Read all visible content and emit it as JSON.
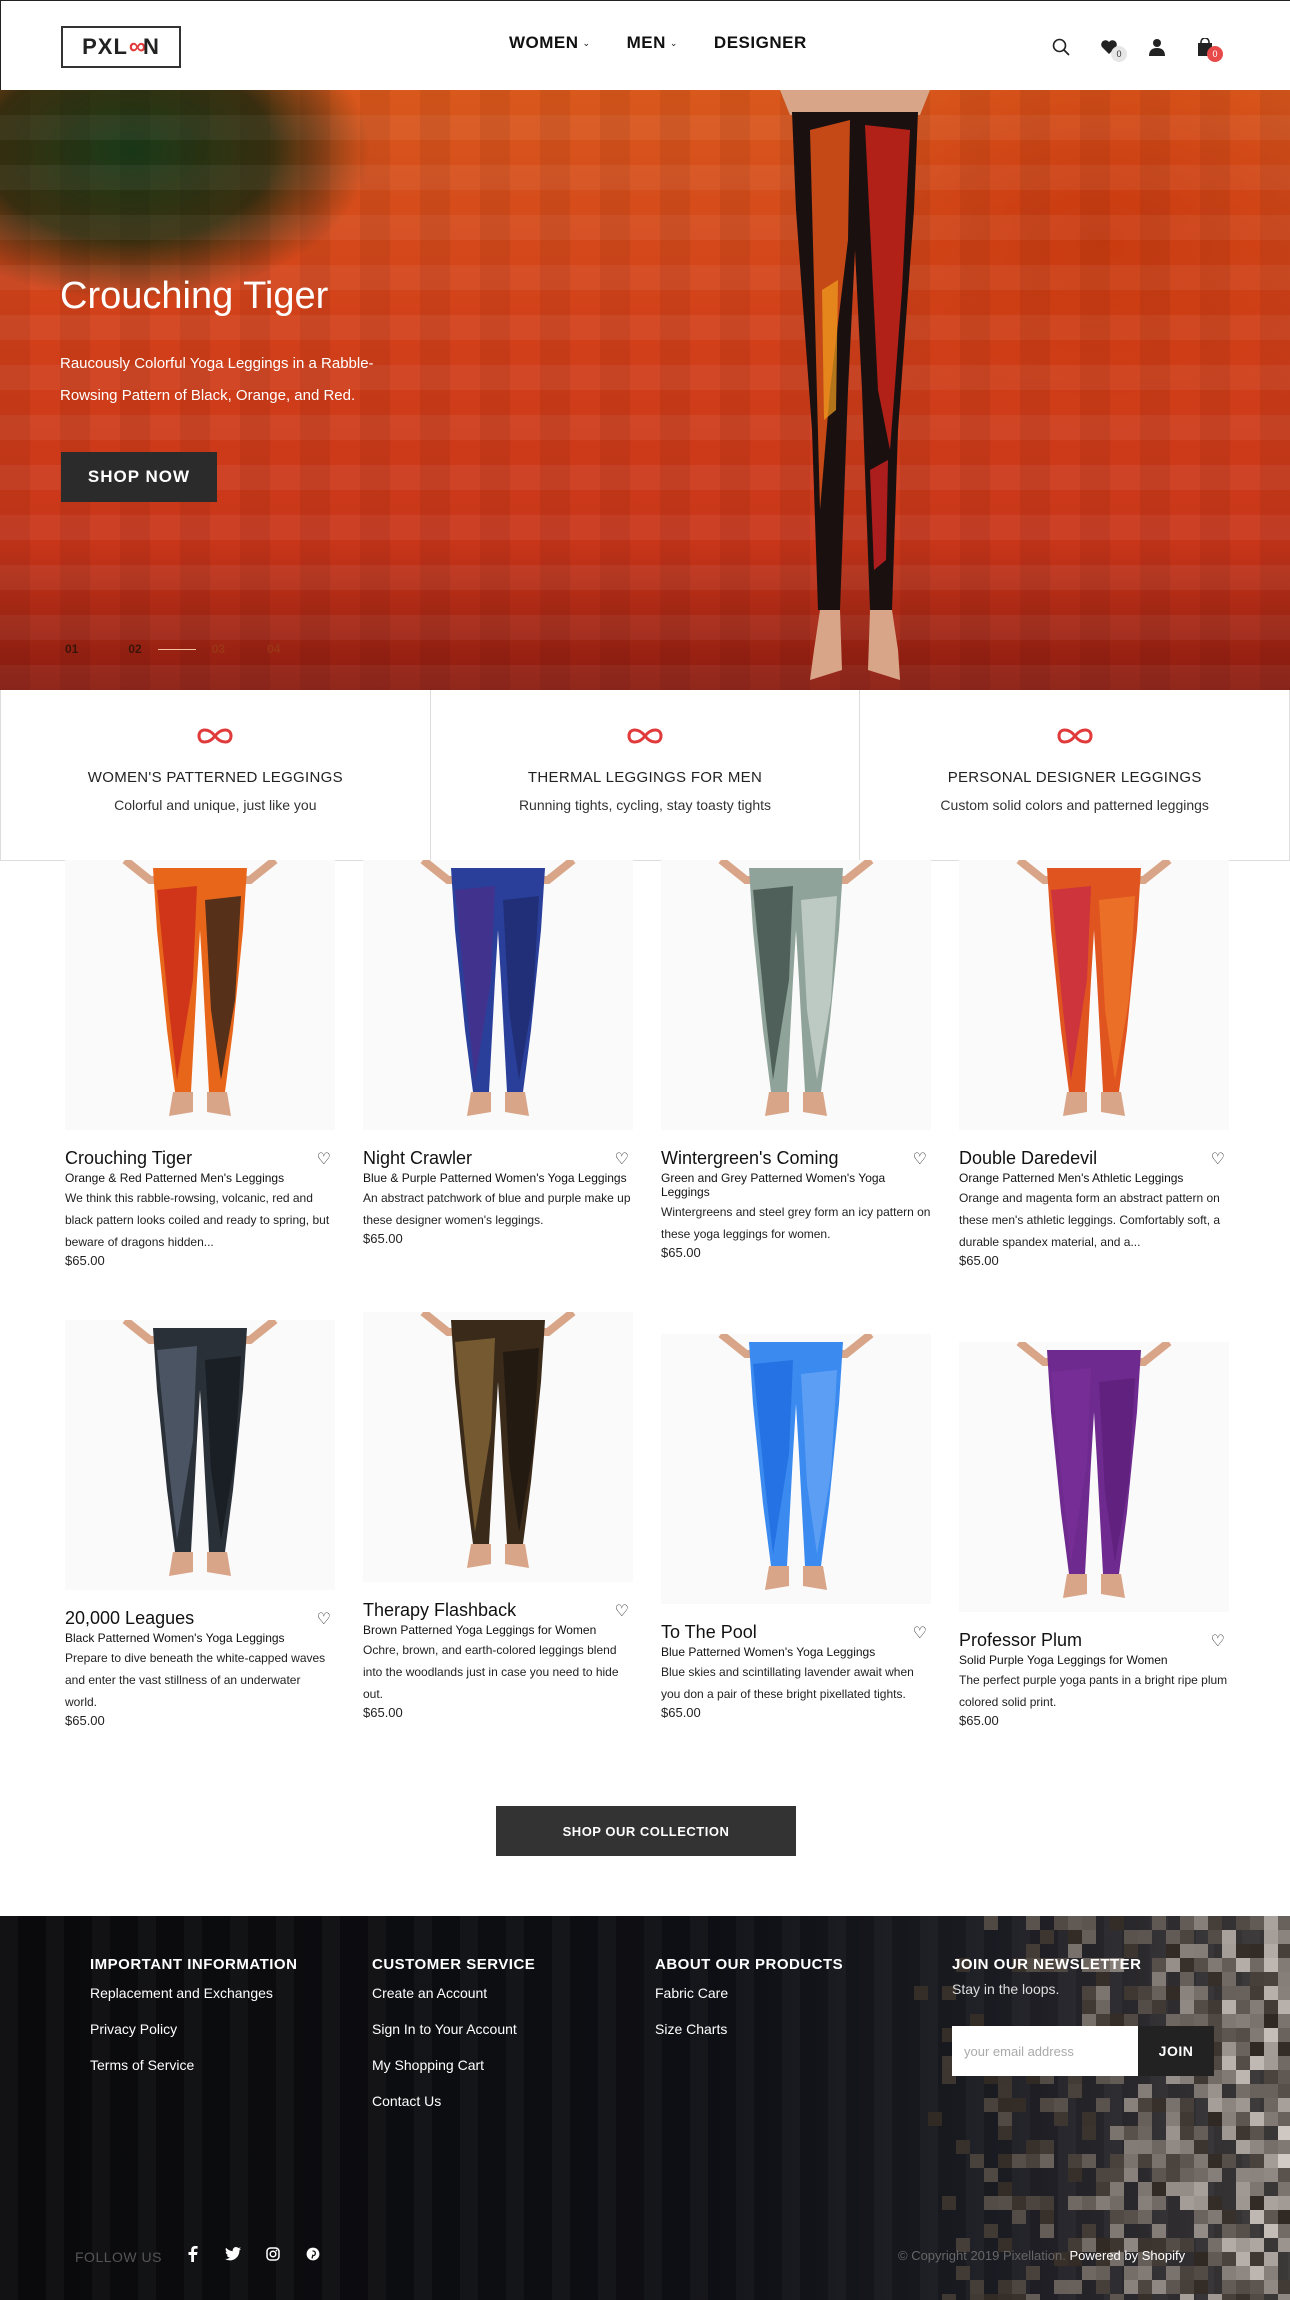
{
  "header": {
    "logo_text_left": "PXL",
    "logo_loop": "∞",
    "logo_text_right": "N",
    "nav": [
      {
        "label": "WOMEN",
        "has_dropdown": true
      },
      {
        "label": "MEN",
        "has_dropdown": true
      },
      {
        "label": "DESIGNER",
        "has_dropdown": false
      }
    ],
    "wishlist_count": "0",
    "cart_count": "0"
  },
  "hero": {
    "title": "Crouching Tiger",
    "subtitle": "Raucously Colorful Yoga Leggings in a Rabble-Rowsing Pattern of Black, Orange, and Red.",
    "button": "SHOP NOW",
    "slides": [
      "01",
      "02",
      "03",
      "04"
    ],
    "active_slide": "02"
  },
  "features": [
    {
      "title": "WOMEN'S PATTERNED LEGGINGS",
      "desc": "Colorful and unique, just like you"
    },
    {
      "title": "THERMAL LEGGINGS FOR MEN",
      "desc": "Running tights, cycling, stay toasty tights"
    },
    {
      "title": "PERSONAL DESIGNER LEGGINGS",
      "desc": "Custom solid colors and patterned leggings"
    }
  ],
  "products": [
    {
      "name": "Crouching Tiger",
      "sub": "Orange & Red Patterned Men's Leggings",
      "desc": "We think this rabble-rowsing, volcanic, red and black pattern looks coiled and ready to spring, but beware of dragons hidden...",
      "price": "$65.00",
      "colors": [
        "#e8661a",
        "#c8251a",
        "#1a1a1a"
      ]
    },
    {
      "name": "Night Crawler",
      "sub": "Blue & Purple Patterned Women's Yoga Leggings",
      "desc": "An abstract patchwork of blue and purple make up these designer women's leggings.",
      "price": "$65.00",
      "colors": [
        "#2a3f9a",
        "#4a2f8a",
        "#1c2a6a"
      ]
    },
    {
      "name": "Wintergreen's Coming",
      "sub": "Green and Grey Patterned Women's Yoga Leggings",
      "desc": "Wintergreens and steel grey form an icy pattern on these yoga leggings for women.",
      "price": "$65.00",
      "colors": [
        "#8fa39a",
        "#3a4a44",
        "#d0d8d4"
      ]
    },
    {
      "name": "Double Daredevil",
      "sub": "Orange Patterned Men's Athletic Leggings",
      "desc": "Orange and magenta form an abstract pattern on these men's athletic leggings. Comfortably soft, a durable spandex material, and a...",
      "price": "$65.00",
      "colors": [
        "#e0541f",
        "#c72a45",
        "#f07a2a"
      ]
    },
    {
      "name": "20,000 Leagues",
      "sub": "Black Patterned Women's Yoga Leggings",
      "desc": "Prepare to dive beneath the white-capped waves and enter the vast stillness of an underwater world.",
      "price": "$65.00",
      "colors": [
        "#2a3038",
        "#566070",
        "#14181e"
      ]
    },
    {
      "name": "Therapy Flashback",
      "sub": "Brown Patterned Yoga Leggings for Women",
      "desc": "Ochre, brown, and earth-colored leggings blend into the woodlands just in case you need to hide out.",
      "price": "$65.00",
      "colors": [
        "#3a2a1a",
        "#8a6a3a",
        "#1a140e"
      ]
    },
    {
      "name": "To The Pool",
      "sub": "Blue Patterned Women's Yoga Leggings",
      "desc": "Blue skies and scintillating lavender await when you don a pair of these bright pixellated tights.",
      "price": "$65.00",
      "colors": [
        "#3a8af0",
        "#1f6ae0",
        "#6aa6f5"
      ]
    },
    {
      "name": "Professor Plum",
      "sub": "Solid Purple Yoga Leggings for Women",
      "desc": "The perfect purple yoga pants in a bright ripe plum colored solid print.",
      "price": "$65.00",
      "colors": [
        "#6e2a8e",
        "#7a3098",
        "#5a2078"
      ]
    }
  ],
  "collection_button": "SHOP OUR COLLECTION",
  "footer": {
    "columns": [
      {
        "heading": "IMPORTANT INFORMATION",
        "links": [
          "Replacement and Exchanges",
          "Privacy Policy",
          "Terms of Service"
        ]
      },
      {
        "heading": "CUSTOMER SERVICE",
        "links": [
          "Create an Account",
          "Sign In to Your Account",
          "My Shopping Cart",
          "Contact Us"
        ]
      },
      {
        "heading": "ABOUT OUR PRODUCTS",
        "links": [
          "Fabric Care",
          "Size Charts"
        ]
      }
    ],
    "newsletter": {
      "heading": "JOIN OUR NEWSLETTER",
      "sub": "Stay in the loops.",
      "placeholder": "your email address",
      "button": "JOIN"
    },
    "follow_label": "FOLLOW US",
    "social_icons": [
      "facebook-icon",
      "twitter-icon",
      "instagram-icon",
      "pinterest-icon"
    ],
    "copyright": "© Copyright 2019 Pixellation.",
    "powered": "Powered by Shopify"
  },
  "colors": {
    "accent": "#e03a3a",
    "dark_button": "#2b2b2b",
    "badge_red": "#e84a4a"
  }
}
